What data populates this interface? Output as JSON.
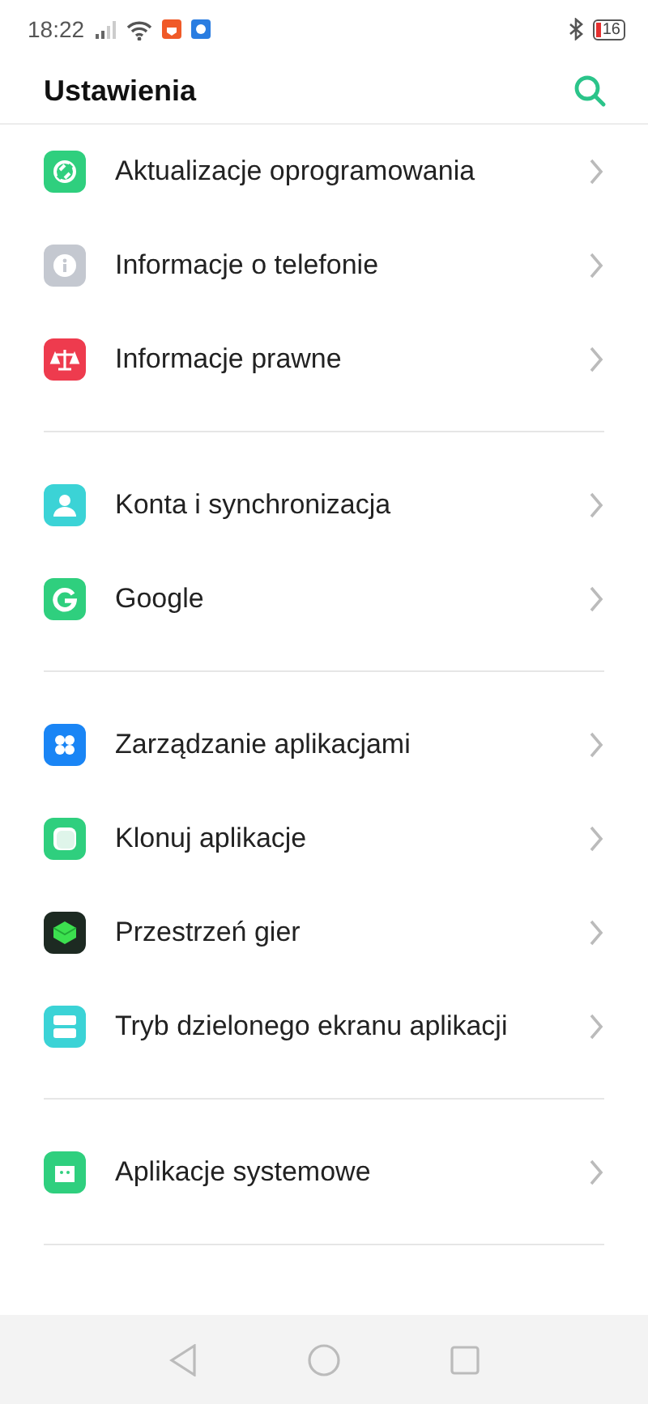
{
  "status_bar": {
    "time": "18:22",
    "battery": "16"
  },
  "header": {
    "title": "Ustawienia"
  },
  "groups": [
    {
      "items": [
        {
          "kind": "update",
          "label": "Aktualizacje oprogramowania"
        },
        {
          "kind": "info",
          "label": "Informacje o telefonie"
        },
        {
          "kind": "legal",
          "label": "Informacje prawne"
        }
      ]
    },
    {
      "items": [
        {
          "kind": "account",
          "label": "Konta i synchronizacja"
        },
        {
          "kind": "google",
          "label": "Google"
        }
      ]
    },
    {
      "items": [
        {
          "kind": "apps",
          "label": "Zarządzanie aplikacjami"
        },
        {
          "kind": "clone",
          "label": "Klonuj aplikacje"
        },
        {
          "kind": "game",
          "label": "Przestrzeń gier"
        },
        {
          "kind": "split",
          "label": "Tryb dzielonego ekranu aplikacji"
        }
      ]
    },
    {
      "items": [
        {
          "kind": "system",
          "label": "Aplikacje systemowe"
        }
      ]
    }
  ]
}
